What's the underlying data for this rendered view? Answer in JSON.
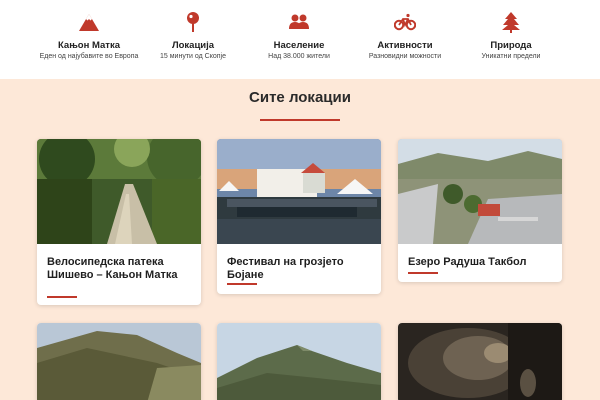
{
  "features": [
    {
      "icon": "mountain-icon",
      "title": "Кањон Матка",
      "subtitle": "Еден од најубавите во Европа"
    },
    {
      "icon": "map-pin-icon",
      "title": "Локација",
      "subtitle": "15 минути од Скопје"
    },
    {
      "icon": "people-icon",
      "title": "Население",
      "subtitle": "Над 38.000 жители"
    },
    {
      "icon": "bicycle-icon",
      "title": "Активности",
      "subtitle": "Разновидни можности"
    },
    {
      "icon": "tree-icon",
      "title": "Природа",
      "subtitle": "Уникатни предели"
    }
  ],
  "locations": {
    "heading": "Сите локации",
    "cards": [
      {
        "title": "Велосипедска патека Шишево – Кањон Матка"
      },
      {
        "title": "Фестивал на грозјето Бојане"
      },
      {
        "title": "Езеро Радуша Такбол"
      },
      {
        "title": ""
      },
      {
        "title": ""
      },
      {
        "title": ""
      }
    ]
  },
  "colors": {
    "accent": "#c0392b",
    "background": "#fde8d8"
  }
}
